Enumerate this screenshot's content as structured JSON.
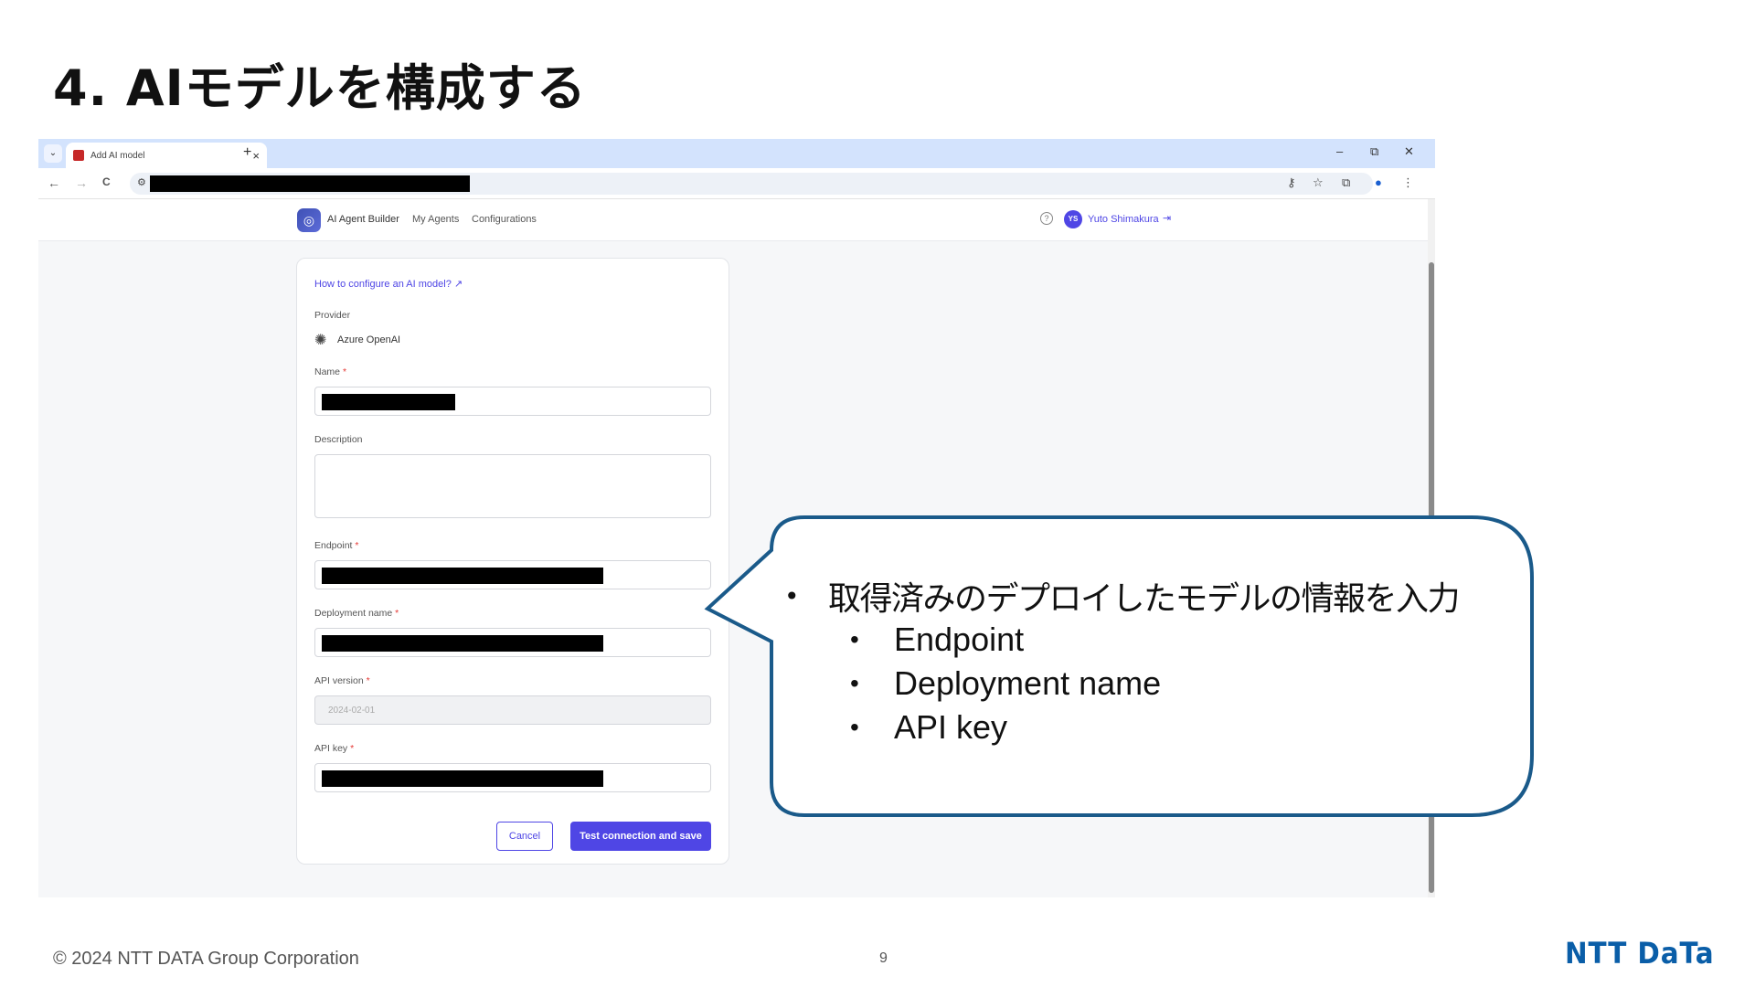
{
  "slide": {
    "title": "4. AIモデルを構成する",
    "footer": {
      "copyright": "© 2024 NTT DATA Group Corporation",
      "page_number": "9",
      "logo_text": "NTT DaTa"
    }
  },
  "browser": {
    "tab_menu_icon": "chevron-down-icon",
    "tab_title": "Add AI model",
    "tab_close": "×",
    "new_tab": "+",
    "window_controls": {
      "minimize": "–",
      "restore": "⧉",
      "close": "✕"
    },
    "nav": {
      "back": "←",
      "forward": "→",
      "reload": "C"
    },
    "toolbar_icons": [
      "key-icon",
      "star-icon",
      "extensions-icon",
      "profile-icon",
      "more-icon"
    ]
  },
  "app": {
    "brand": "AI Agent Builder",
    "nav": [
      "My Agents",
      "Configurations"
    ],
    "user": {
      "initials": "YS",
      "name": "Yuto Shimakura"
    },
    "accent_color": "#4f46e5"
  },
  "form": {
    "help_link": "How to configure an AI model? ↗",
    "provider": {
      "label": "Provider",
      "value": "Azure OpenAI"
    },
    "fields": {
      "name": {
        "label": "Name",
        "required": "*"
      },
      "description": {
        "label": "Description"
      },
      "endpoint": {
        "label": "Endpoint",
        "required": "*"
      },
      "deployment_name": {
        "label": "Deployment name",
        "required": "*"
      },
      "api_version": {
        "label": "API version",
        "required": "*",
        "value": "2024-02-01"
      },
      "api_key": {
        "label": "API key",
        "required": "*"
      }
    },
    "buttons": {
      "cancel": "Cancel",
      "save": "Test connection and save"
    }
  },
  "callout": {
    "main": "取得済みのデプロイしたモデルの情報を入力",
    "items": [
      "Endpoint",
      "Deployment name",
      "API key"
    ],
    "border_color": "#1a5a8a"
  }
}
